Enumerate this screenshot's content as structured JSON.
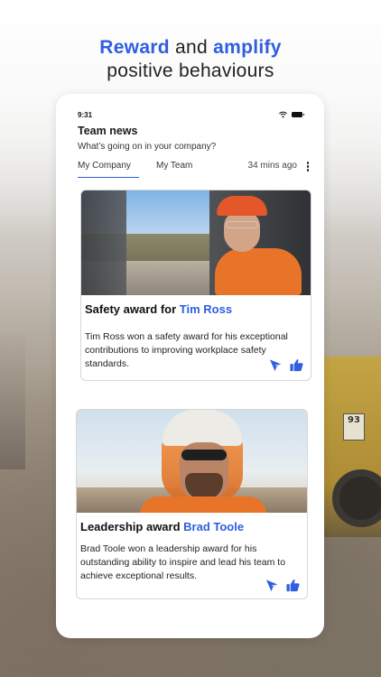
{
  "headline": {
    "word1": "Reward",
    "and": " and ",
    "word2": "amplify",
    "line2": "positive behaviours"
  },
  "status_bar": {
    "time": "9:31",
    "icons": [
      "wifi-icon",
      "battery-icon"
    ]
  },
  "screen": {
    "title": "Team news",
    "subtitle": "What’s going on in your company?"
  },
  "tabs": {
    "items": [
      {
        "label": "My Company",
        "active": true
      },
      {
        "label": "My Team",
        "active": false
      }
    ],
    "time_ago": "34 mins ago"
  },
  "cards": [
    {
      "title_prefix": "Safety award for ",
      "name": "Tim Ross",
      "body": "Tim Ross won a safety award for his exceptional contributions to improving workplace safety standards."
    },
    {
      "title_prefix": "Leadership award ",
      "name": "Brad Toole",
      "body": "Brad Toole won a leadership award for his outstanding ability to inspire and lead his team to achieve exceptional results."
    }
  ],
  "colors": {
    "accent": "#2f5ee0",
    "text": "#111111"
  },
  "background": {
    "truck_number": "93"
  }
}
